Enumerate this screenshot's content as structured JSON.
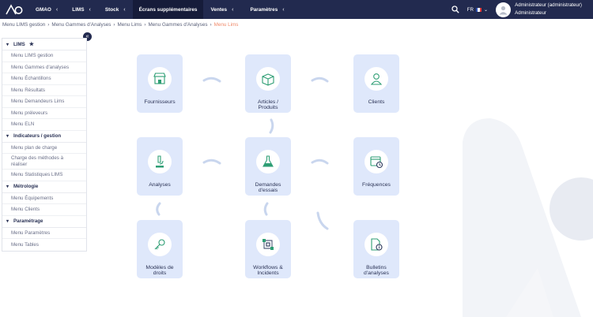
{
  "nav": {
    "items": [
      {
        "label": "GMAO",
        "active": false
      },
      {
        "label": "LIMS",
        "active": false
      },
      {
        "label": "Stock",
        "active": false
      },
      {
        "label": "Écrans supplémentaires",
        "active": true
      },
      {
        "label": "Ventes",
        "active": false
      },
      {
        "label": "Paramètres",
        "active": false
      }
    ],
    "lang": "FR",
    "user_name": "Administrateur (administrateur)",
    "user_role": "Administrateur"
  },
  "breadcrumb": [
    "Menu LIMS gestion",
    "Menu Gammes d'Analyses",
    "Menu Lims",
    "Menu Gammes d'Analyses",
    "Menu Lims"
  ],
  "sidebar": {
    "sections": [
      {
        "title": "LIMS",
        "items": [
          "Menu LIMS gestion",
          "Menu Gammes d'analyses",
          "Menu Échantillons",
          "Menu Résultats",
          "Menu Demandeurs Lims",
          "Menu préleveurs",
          "Menu ELN"
        ]
      },
      {
        "title": "Indicateurs / gestion",
        "items": [
          "Menu plan de charge",
          "Charge des méthodes à réaliser",
          "Menu Statistiques LIMS"
        ]
      },
      {
        "title": "Métrologie",
        "items": [
          "Menu Équipements",
          "Menu Clients"
        ]
      },
      {
        "title": "Paramétrage",
        "items": [
          "Menu Paramètres",
          "Menu Tables"
        ]
      }
    ]
  },
  "cards": [
    {
      "label": "Fournisseurs",
      "icon": "store-icon"
    },
    {
      "label": "Articles / Produits",
      "icon": "box-icon"
    },
    {
      "label": "Clients",
      "icon": "person-icon"
    },
    {
      "label": "Analyses",
      "icon": "microscope-icon"
    },
    {
      "label": "Demandes d'essais",
      "icon": "flask-icon"
    },
    {
      "label": "Fréquences",
      "icon": "calendar-clock-icon"
    },
    {
      "label": "Modèles de droits",
      "icon": "key-icon"
    },
    {
      "label": "Workflows & Incidents",
      "icon": "workflow-icon"
    },
    {
      "label": "Bulletins d'analyses",
      "icon": "document-info-icon"
    }
  ],
  "colors": {
    "navbar": "#222a4f",
    "card": "#dfe8fb",
    "accent_green": "#2e9e74",
    "breadcrumb_current": "#f08a6a"
  }
}
